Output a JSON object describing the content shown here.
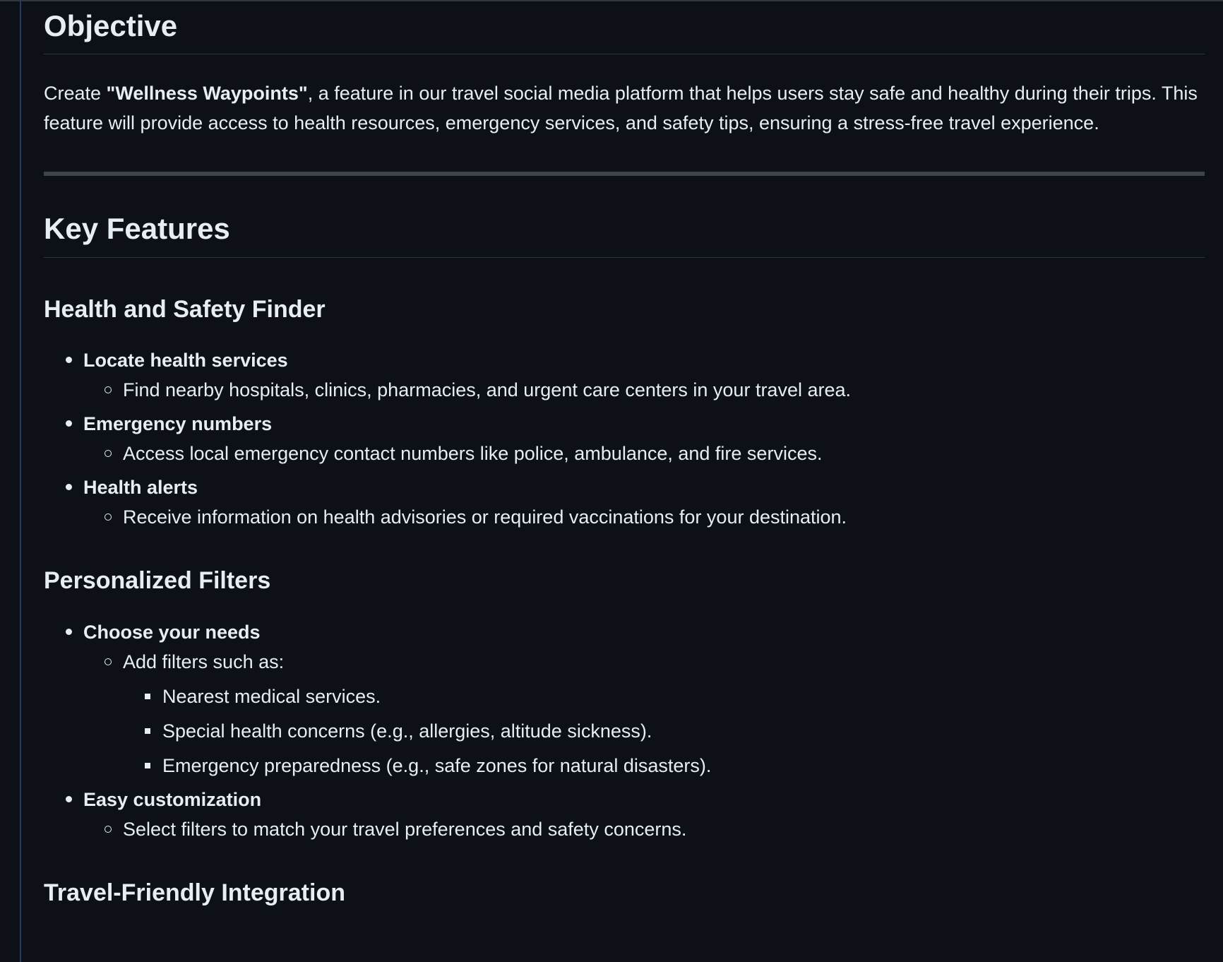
{
  "objective": {
    "heading": "Objective",
    "para_prefix": "Create ",
    "para_bold": "\"Wellness Waypoints\"",
    "para_rest": ", a feature in our travel social media platform that helps users stay safe and healthy during their trips. This feature will provide access to health resources, emergency services, and safety tips, ensuring a stress-free travel experience."
  },
  "key_features": {
    "heading": "Key Features",
    "health_safety": {
      "heading": "Health and Safety Finder",
      "items": [
        {
          "title": "Locate health services",
          "sub": "Find nearby hospitals, clinics, pharmacies, and urgent care centers in your travel area."
        },
        {
          "title": "Emergency numbers",
          "sub": "Access local emergency contact numbers like police, ambulance, and fire services."
        },
        {
          "title": "Health alerts",
          "sub": "Receive information on health advisories or required vaccinations for your destination."
        }
      ]
    },
    "personalized": {
      "heading": "Personalized Filters",
      "choose_title": "Choose your needs",
      "choose_sub": "Add filters such as:",
      "filters": [
        "Nearest medical services.",
        "Special health concerns (e.g., allergies, altitude sickness).",
        "Emergency preparedness (e.g., safe zones for natural disasters)."
      ],
      "easy_title": "Easy customization",
      "easy_sub": "Select filters to match your travel preferences and safety concerns."
    },
    "travel_friendly": {
      "heading": "Travel-Friendly Integration"
    }
  }
}
